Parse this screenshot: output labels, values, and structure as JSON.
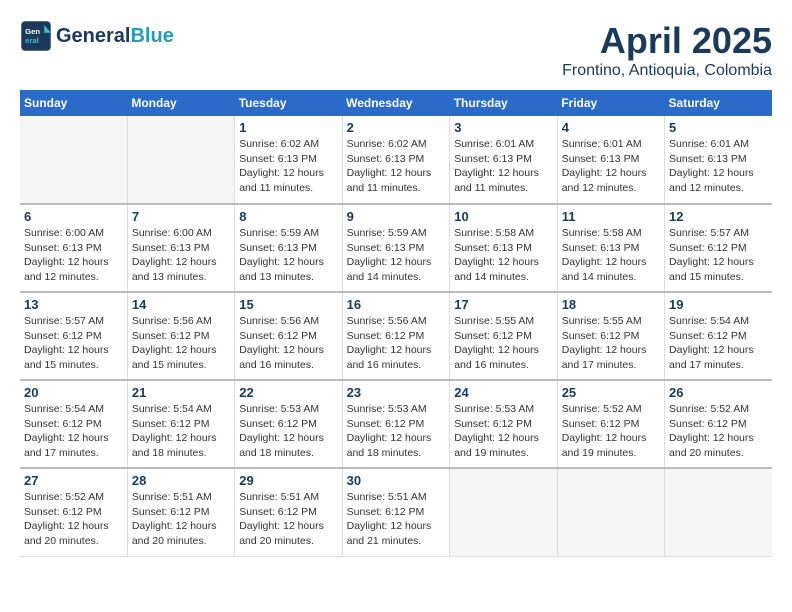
{
  "header": {
    "logo_line1": "General",
    "logo_line2": "Blue",
    "title": "April 2025",
    "subtitle": "Frontino, Antioquia, Colombia"
  },
  "weekdays": [
    "Sunday",
    "Monday",
    "Tuesday",
    "Wednesday",
    "Thursday",
    "Friday",
    "Saturday"
  ],
  "weeks": [
    [
      {
        "day": "",
        "detail": ""
      },
      {
        "day": "",
        "detail": ""
      },
      {
        "day": "1",
        "detail": "Sunrise: 6:02 AM\nSunset: 6:13 PM\nDaylight: 12 hours\nand 11 minutes."
      },
      {
        "day": "2",
        "detail": "Sunrise: 6:02 AM\nSunset: 6:13 PM\nDaylight: 12 hours\nand 11 minutes."
      },
      {
        "day": "3",
        "detail": "Sunrise: 6:01 AM\nSunset: 6:13 PM\nDaylight: 12 hours\nand 11 minutes."
      },
      {
        "day": "4",
        "detail": "Sunrise: 6:01 AM\nSunset: 6:13 PM\nDaylight: 12 hours\nand 12 minutes."
      },
      {
        "day": "5",
        "detail": "Sunrise: 6:01 AM\nSunset: 6:13 PM\nDaylight: 12 hours\nand 12 minutes."
      }
    ],
    [
      {
        "day": "6",
        "detail": "Sunrise: 6:00 AM\nSunset: 6:13 PM\nDaylight: 12 hours\nand 12 minutes."
      },
      {
        "day": "7",
        "detail": "Sunrise: 6:00 AM\nSunset: 6:13 PM\nDaylight: 12 hours\nand 13 minutes."
      },
      {
        "day": "8",
        "detail": "Sunrise: 5:59 AM\nSunset: 6:13 PM\nDaylight: 12 hours\nand 13 minutes."
      },
      {
        "day": "9",
        "detail": "Sunrise: 5:59 AM\nSunset: 6:13 PM\nDaylight: 12 hours\nand 14 minutes."
      },
      {
        "day": "10",
        "detail": "Sunrise: 5:58 AM\nSunset: 6:13 PM\nDaylight: 12 hours\nand 14 minutes."
      },
      {
        "day": "11",
        "detail": "Sunrise: 5:58 AM\nSunset: 6:13 PM\nDaylight: 12 hours\nand 14 minutes."
      },
      {
        "day": "12",
        "detail": "Sunrise: 5:57 AM\nSunset: 6:12 PM\nDaylight: 12 hours\nand 15 minutes."
      }
    ],
    [
      {
        "day": "13",
        "detail": "Sunrise: 5:57 AM\nSunset: 6:12 PM\nDaylight: 12 hours\nand 15 minutes."
      },
      {
        "day": "14",
        "detail": "Sunrise: 5:56 AM\nSunset: 6:12 PM\nDaylight: 12 hours\nand 15 minutes."
      },
      {
        "day": "15",
        "detail": "Sunrise: 5:56 AM\nSunset: 6:12 PM\nDaylight: 12 hours\nand 16 minutes."
      },
      {
        "day": "16",
        "detail": "Sunrise: 5:56 AM\nSunset: 6:12 PM\nDaylight: 12 hours\nand 16 minutes."
      },
      {
        "day": "17",
        "detail": "Sunrise: 5:55 AM\nSunset: 6:12 PM\nDaylight: 12 hours\nand 16 minutes."
      },
      {
        "day": "18",
        "detail": "Sunrise: 5:55 AM\nSunset: 6:12 PM\nDaylight: 12 hours\nand 17 minutes."
      },
      {
        "day": "19",
        "detail": "Sunrise: 5:54 AM\nSunset: 6:12 PM\nDaylight: 12 hours\nand 17 minutes."
      }
    ],
    [
      {
        "day": "20",
        "detail": "Sunrise: 5:54 AM\nSunset: 6:12 PM\nDaylight: 12 hours\nand 17 minutes."
      },
      {
        "day": "21",
        "detail": "Sunrise: 5:54 AM\nSunset: 6:12 PM\nDaylight: 12 hours\nand 18 minutes."
      },
      {
        "day": "22",
        "detail": "Sunrise: 5:53 AM\nSunset: 6:12 PM\nDaylight: 12 hours\nand 18 minutes."
      },
      {
        "day": "23",
        "detail": "Sunrise: 5:53 AM\nSunset: 6:12 PM\nDaylight: 12 hours\nand 18 minutes."
      },
      {
        "day": "24",
        "detail": "Sunrise: 5:53 AM\nSunset: 6:12 PM\nDaylight: 12 hours\nand 19 minutes."
      },
      {
        "day": "25",
        "detail": "Sunrise: 5:52 AM\nSunset: 6:12 PM\nDaylight: 12 hours\nand 19 minutes."
      },
      {
        "day": "26",
        "detail": "Sunrise: 5:52 AM\nSunset: 6:12 PM\nDaylight: 12 hours\nand 20 minutes."
      }
    ],
    [
      {
        "day": "27",
        "detail": "Sunrise: 5:52 AM\nSunset: 6:12 PM\nDaylight: 12 hours\nand 20 minutes."
      },
      {
        "day": "28",
        "detail": "Sunrise: 5:51 AM\nSunset: 6:12 PM\nDaylight: 12 hours\nand 20 minutes."
      },
      {
        "day": "29",
        "detail": "Sunrise: 5:51 AM\nSunset: 6:12 PM\nDaylight: 12 hours\nand 20 minutes."
      },
      {
        "day": "30",
        "detail": "Sunrise: 5:51 AM\nSunset: 6:12 PM\nDaylight: 12 hours\nand 21 minutes."
      },
      {
        "day": "",
        "detail": ""
      },
      {
        "day": "",
        "detail": ""
      },
      {
        "day": "",
        "detail": ""
      }
    ]
  ]
}
